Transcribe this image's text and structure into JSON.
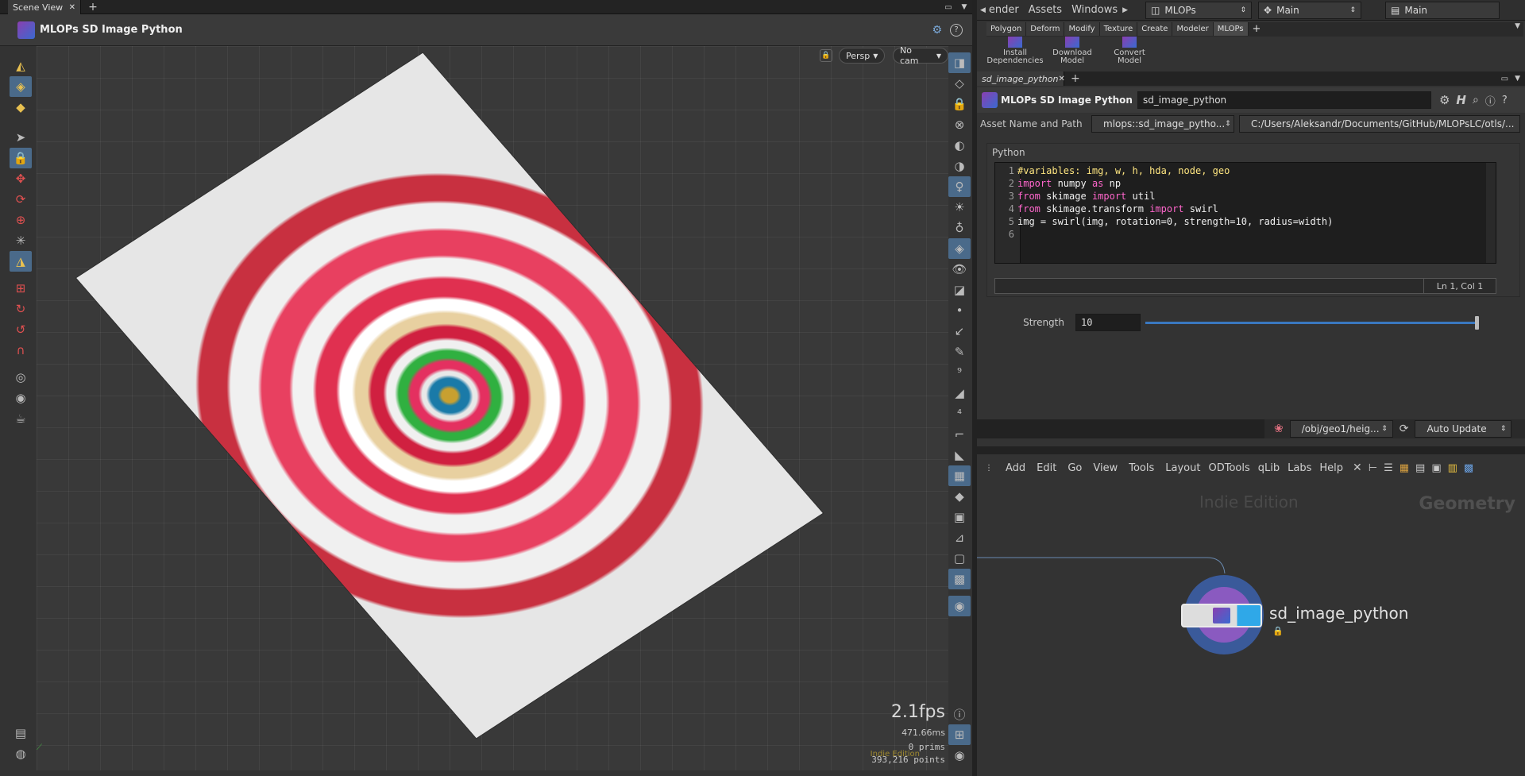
{
  "left_pane": {
    "tab_label": "Scene View",
    "viewer_title": "MLOPs SD Image Python",
    "persp_label": "Persp",
    "cam_label": "No cam",
    "fps": "2.1fps",
    "time": "471.66ms",
    "prims": "0  prims",
    "points": "393,216 points",
    "edition_watermark": "Indie Edition"
  },
  "right_pane": {
    "menu": {
      "render": "ender",
      "assets": "Assets",
      "windows": "Windows",
      "desktop": "MLOPs",
      "main_1": "Main",
      "main_2": "Main"
    },
    "shelf_tabs": [
      "Polygon",
      "Deform",
      "Modify",
      "Texture",
      "Create",
      "Modeler",
      "MLOPs"
    ],
    "shelf_tools": [
      {
        "line1": "Install",
        "line2": "Dependencies"
      },
      {
        "line1": "Download",
        "line2": "Model"
      },
      {
        "line1": "Convert",
        "line2": "Model"
      }
    ],
    "param_tab": "sd_image_python",
    "node_type": "MLOPs SD Image Python",
    "node_name": "sd_image_python",
    "asset_label": "Asset Name and Path",
    "asset_name": "mlops::sd_image_pytho...",
    "asset_path": "C:/Users/Aleksandr/Documents/GitHub/MLOPsLC/otls/...",
    "python_label": "Python",
    "code_lines": [
      {
        "n": "1",
        "t": "#variables: img, w, h, hda, node, geo"
      },
      {
        "n": "2",
        "t": "import numpy as np"
      },
      {
        "n": "3",
        "t": "from skimage import util"
      },
      {
        "n": "4",
        "t": "from skimage.transform import swirl"
      },
      {
        "n": "5",
        "t": "img = swirl(img, rotation=0, strength=10, radius=width)"
      },
      {
        "n": "6",
        "t": ""
      }
    ],
    "cursor_pos": "Ln 1, Col 1",
    "strength_label": "Strength",
    "strength_value": "10",
    "strength_fraction": 1.0,
    "path_combo": "/obj/geo1/heig...",
    "auto_update": "Auto Update",
    "network_menu": [
      "Add",
      "Edit",
      "Go",
      "View",
      "Tools",
      "Layout",
      "ODTools",
      "qLib",
      "Labs",
      "Help"
    ],
    "network_watermark": "Indie Edition",
    "network_context": "Geometry",
    "node_label": "sd_image_python"
  }
}
